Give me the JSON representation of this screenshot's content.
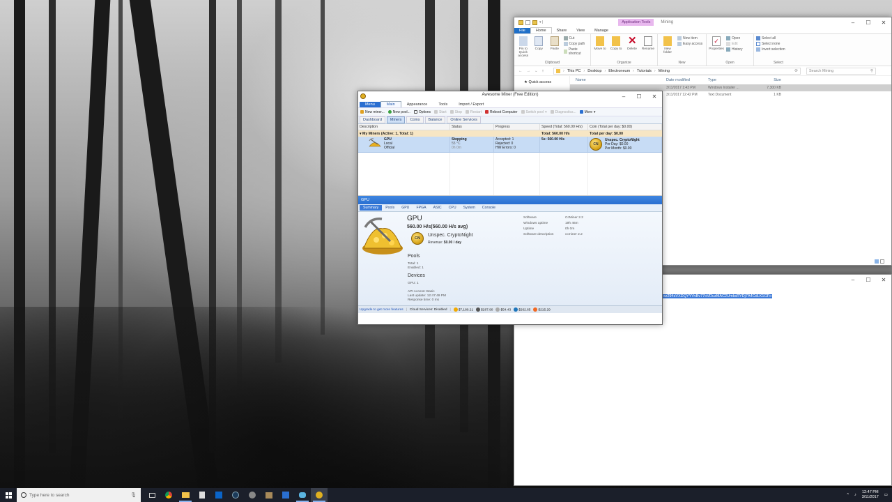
{
  "explorer": {
    "context_tab": "Application Tools",
    "context_title": "Mining",
    "tabs": [
      "File",
      "Home",
      "Share",
      "View",
      "Manage"
    ],
    "ribbon": {
      "clipboard": {
        "label": "Clipboard",
        "pin": "Pin to Quick access",
        "copy": "Copy",
        "paste": "Paste",
        "cut": "Cut",
        "copy_path": "Copy path",
        "paste_shortcut": "Paste shortcut"
      },
      "organize": {
        "label": "Organize",
        "move_to": "Move to",
        "copy_to": "Copy to",
        "delete": "Delete",
        "rename": "Rename"
      },
      "new": {
        "label": "New",
        "new_folder": "New folder",
        "new_item": "New item",
        "easy_access": "Easy access"
      },
      "open": {
        "label": "Open",
        "properties": "Properties",
        "open": "Open",
        "edit": "Edit",
        "history": "History"
      },
      "select": {
        "label": "Select",
        "select_all": "Select all",
        "select_none": "Select none",
        "invert": "Invert selection"
      }
    },
    "breadcrumbs": [
      "This PC",
      "Desktop",
      "Electroneum",
      "Tutorials",
      "Mining"
    ],
    "search_placeholder": "Search Mining",
    "nav_quick_access": "Quick access",
    "columns": [
      "Name",
      "Date modified",
      "Type",
      "Size"
    ],
    "files": [
      {
        "name": "",
        "date": "3/11/2017 1:43 PM",
        "type": "Windows Installer ...",
        "size": "7,300 KB"
      },
      {
        "name": "",
        "date": "3/11/2017 12:42 PM",
        "type": "Text Document",
        "size": "1 KB"
      }
    ]
  },
  "notepad": {
    "selected_text": "xz294sVXDQYYVvBv77oVDuzMAC2UmksRYDj7A4CdLK1GFo"
  },
  "miner": {
    "title": "Awesome Miner (Free Edition)",
    "menu": [
      "Menu",
      "Main",
      "Appearance",
      "Tools",
      "Import / Export"
    ],
    "toolbar": [
      "New miner...",
      "New pool...",
      "Options",
      "Start",
      "Stop",
      "Restart",
      "Reboot Computer",
      "Switch pool",
      "Diagnostics...",
      "More"
    ],
    "tabs": [
      "Dashboard",
      "Miners",
      "Coins",
      "Balance",
      "Online Services"
    ],
    "columns": {
      "description": "Description",
      "status": "Status",
      "progress": "Progress",
      "speed": "Speed (Total: 560.00 H/s)",
      "coin": "Coin (Total per day: $0.00)"
    },
    "group": {
      "label": "My Miners (Active: 1, Total: 1)",
      "speed": "Total: 560.00 H/s",
      "coin": "Total per day: $0.00"
    },
    "row": {
      "name": "GPU",
      "location": "Local",
      "type": "Official",
      "status": "Stopping",
      "temp": "55 °C",
      "time": "0h 0m",
      "accepted": "Accepted: 1",
      "rejected": "Rejected: 0",
      "hw_errors": "HW Errors: 0",
      "speed": "5s: 560.00 H/s",
      "coin_badge": "CN",
      "coin_name": "Unspec. CryptoNight",
      "per_day": "Per Day: $0.00",
      "per_month": "Per Month: $0.00"
    },
    "detail": {
      "header": "GPU",
      "tabs": [
        "Summary",
        "Pools",
        "GPU",
        "FPGA",
        "ASIC",
        "CPU",
        "System",
        "Console"
      ],
      "title": "GPU",
      "hashrate": "560.00 H/s(560.00 H/s avg)",
      "coin_badge": "CN",
      "coin_name": "Unspec. CryptoNight",
      "revenue_label": "Revenue: ",
      "revenue_value": "$0.00 / day",
      "pools_title": "Pools",
      "pools_total": "Total: 1",
      "pools_enabled": "Enabled: 1",
      "devices_title": "Devices",
      "devices_gpu": "GPU: 1",
      "api_access": "API Access: Basic",
      "last_update": "Last update: 12:47:49 PM",
      "response_time": "Response time: 0 ms",
      "info": [
        {
          "label": "Software",
          "value": "CcMiner 2.2"
        },
        {
          "label": "Windows uptime",
          "value": "19h 46m"
        },
        {
          "label": "Uptime",
          "value": "0h 0m"
        },
        {
          "label": "Software description",
          "value": "ccminer 2.2"
        }
      ]
    },
    "statusbar": {
      "upgrade": "Upgrade to get more features",
      "cloud": "Cloud Services: Disabled",
      "prices": [
        "$7,180.21",
        "$287.90",
        "$54.43",
        "$262.65",
        "$215.29"
      ]
    }
  },
  "taskbar": {
    "search_placeholder": "Type here to search",
    "time": "12:47 PM",
    "date": "3/11/2017"
  }
}
